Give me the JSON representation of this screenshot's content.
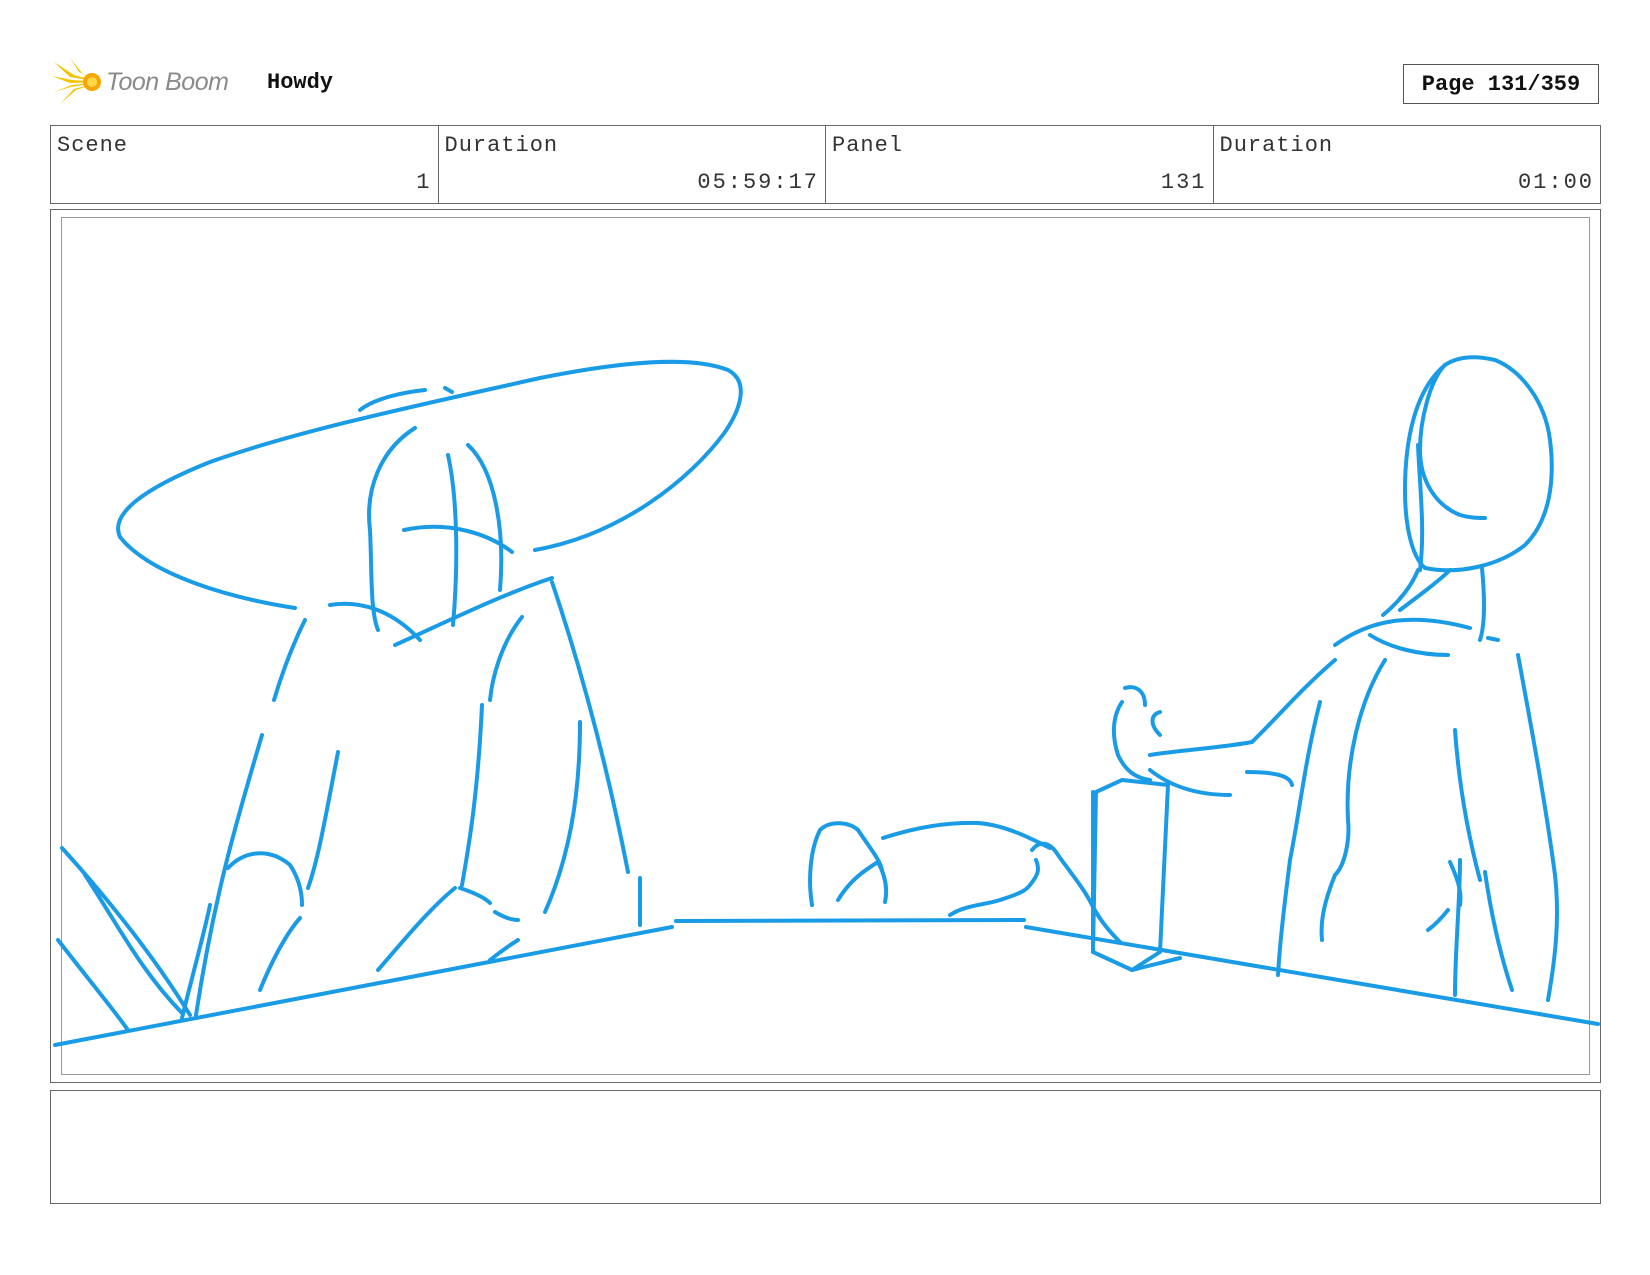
{
  "header": {
    "logo_text": "Toon Boom",
    "project_title": "Howdy",
    "page_label": "Page 131/359"
  },
  "info": {
    "scene_label": "Scene",
    "scene_value": "1",
    "scene_duration_label": "Duration",
    "scene_duration_value": "05:59:17",
    "panel_label": "Panel",
    "panel_value": "131",
    "panel_duration_label": "Duration",
    "panel_duration_value": "01:00"
  },
  "notes": {
    "text": ""
  },
  "colors": {
    "sketch_stroke": "#1a9be6",
    "logo_star": "#f5c400",
    "logo_text": "#8a8a8a"
  }
}
